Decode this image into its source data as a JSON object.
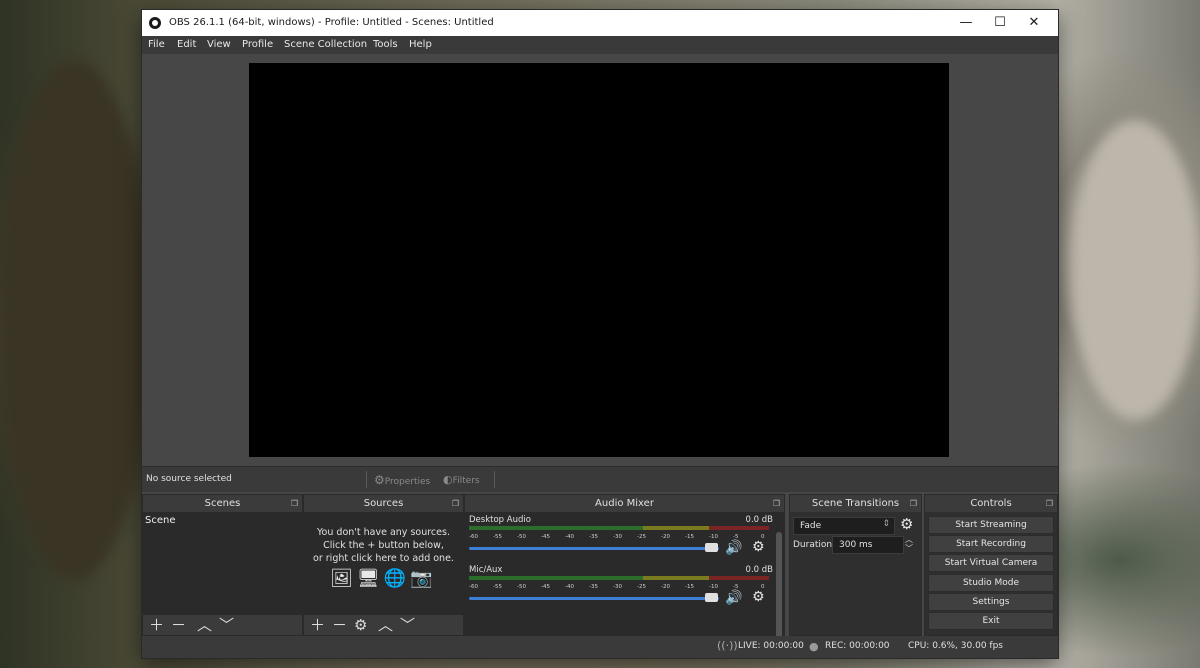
{
  "window": {
    "title": "OBS 26.1.1 (64-bit, windows) - Profile: Untitled - Scenes: Untitled",
    "controls": {
      "minimize": "—",
      "maximize": "☐",
      "close": "✕"
    }
  },
  "menu": [
    "File",
    "Edit",
    "View",
    "Profile",
    "Scene Collection",
    "Tools",
    "Help"
  ],
  "source_toolbar": {
    "status": "No source selected",
    "properties_label": "Properties",
    "filters_label": "Filters"
  },
  "docks": {
    "scenes": {
      "title": "Scenes",
      "items": [
        "Scene"
      ]
    },
    "sources": {
      "title": "Sources",
      "empty_message": [
        "You don't have any sources.",
        "Click the + button below,",
        "or right click here to add one."
      ]
    },
    "audio_mixer": {
      "title": "Audio Mixer",
      "ticks": [
        "-60",
        "-55",
        "-50",
        "-45",
        "-40",
        "-35",
        "-30",
        "-25",
        "-20",
        "-15",
        "-10",
        "-5",
        "0"
      ],
      "channels": [
        {
          "name": "Desktop Audio",
          "level": "0.0 dB",
          "volume_fraction": 1.0
        },
        {
          "name": "Mic/Aux",
          "level": "0.0 dB",
          "volume_fraction": 1.0
        }
      ]
    },
    "scene_transitions": {
      "title": "Scene Transitions",
      "transition": "Fade",
      "duration_label": "Duration",
      "duration_value": "300 ms"
    },
    "controls": {
      "title": "Controls",
      "buttons": [
        "Start Streaming",
        "Start Recording",
        "Start Virtual Camera",
        "Studio Mode",
        "Settings",
        "Exit"
      ]
    }
  },
  "status": {
    "live": "LIVE: 00:00:00",
    "rec": "REC: 00:00:00",
    "cpu": "CPU: 0.6%, 30.00 fps"
  },
  "colors": {
    "accent_blue": "#3d7fd6",
    "panel_bg": "#2a2a2a",
    "window_bg": "#474747"
  }
}
